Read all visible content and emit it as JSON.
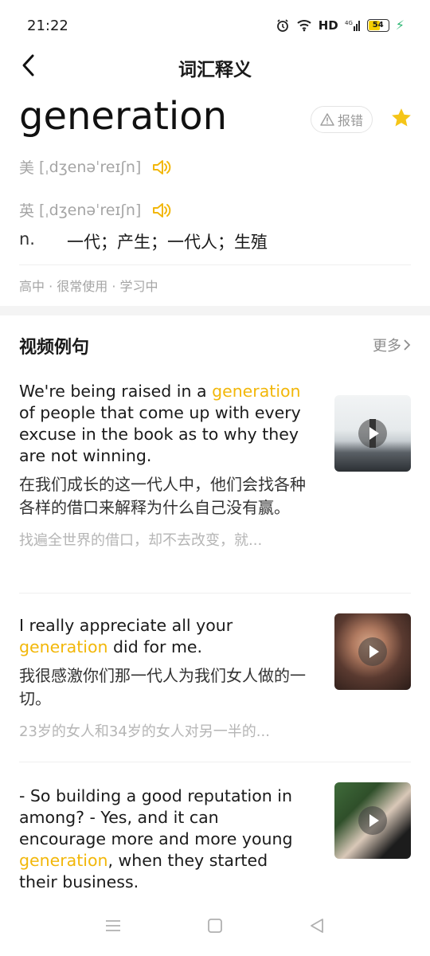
{
  "status": {
    "time": "21:22",
    "network": "HD",
    "battery": "54"
  },
  "nav": {
    "title": "词汇释义"
  },
  "word": {
    "headword": "generation",
    "report_label": "报错",
    "pron_us_label": "美",
    "pron_us": "[ˌdʒenəˈreɪʃn]",
    "pron_uk_label": "英",
    "pron_uk": "[ˌdʒenəˈreɪʃn]",
    "pos": "n.",
    "definition": "一代；产生；一代人；生殖",
    "tags": "高中 · 很常使用 · 学习中"
  },
  "section": {
    "title": "视频例句",
    "more_label": "更多"
  },
  "examples": [
    {
      "en_before": "We're being raised in a ",
      "en_keyword": "generation",
      "en_after": " of people that come up with every excuse in the book as to why they are not winning.",
      "zh": "在我们成长的这一代人中，他们会找各种各样的借口来解释为什么自己没有赢。",
      "source": "找遍全世界的借口，却不去改变，就..."
    },
    {
      "en_before": "I really appreciate all your ",
      "en_keyword": "generation",
      "en_after": " did for me.",
      "zh": "我很感激你们那一代人为我们女人做的一切。",
      "source": "23岁的女人和34岁的女人对另一半的..."
    },
    {
      "en_before": "- So building a good reputation in among? - Yes, and it can encourage more and more young ",
      "en_keyword": "generation",
      "en_after": ",  when they started their business.",
      "zh": "",
      "source": ""
    }
  ],
  "colors": {
    "accent": "#f2b70a",
    "star": "#f5c518"
  },
  "icons": [
    "back-arrow-icon",
    "warning-icon",
    "star-icon",
    "speaker-icon",
    "chevron-right-icon",
    "play-icon",
    "menu-icon",
    "home-icon",
    "back-triangle-icon"
  ]
}
